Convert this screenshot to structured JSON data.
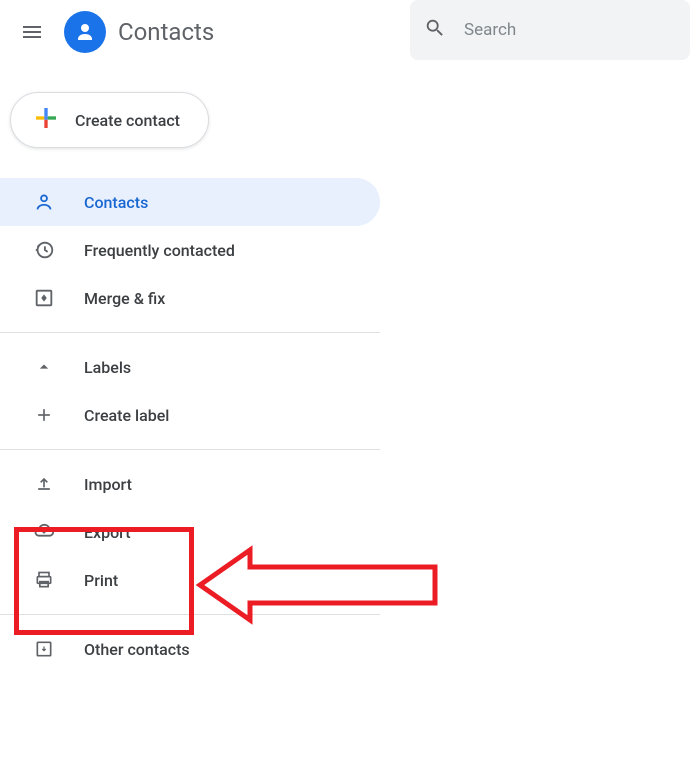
{
  "header": {
    "title": "Contacts",
    "search_placeholder": "Search"
  },
  "sidebar": {
    "create_label": "Create contact",
    "items": {
      "contacts": "Contacts",
      "frequent": "Frequently contacted",
      "merge": "Merge & fix",
      "labels": "Labels",
      "create_label_item": "Create label",
      "import": "Import",
      "export": "Export",
      "print": "Print",
      "other": "Other contacts"
    }
  },
  "colors": {
    "accent": "#1a73e8",
    "active_bg": "#e8f0fe",
    "active_text": "#1967d2",
    "annotation": "#ec1c24"
  }
}
